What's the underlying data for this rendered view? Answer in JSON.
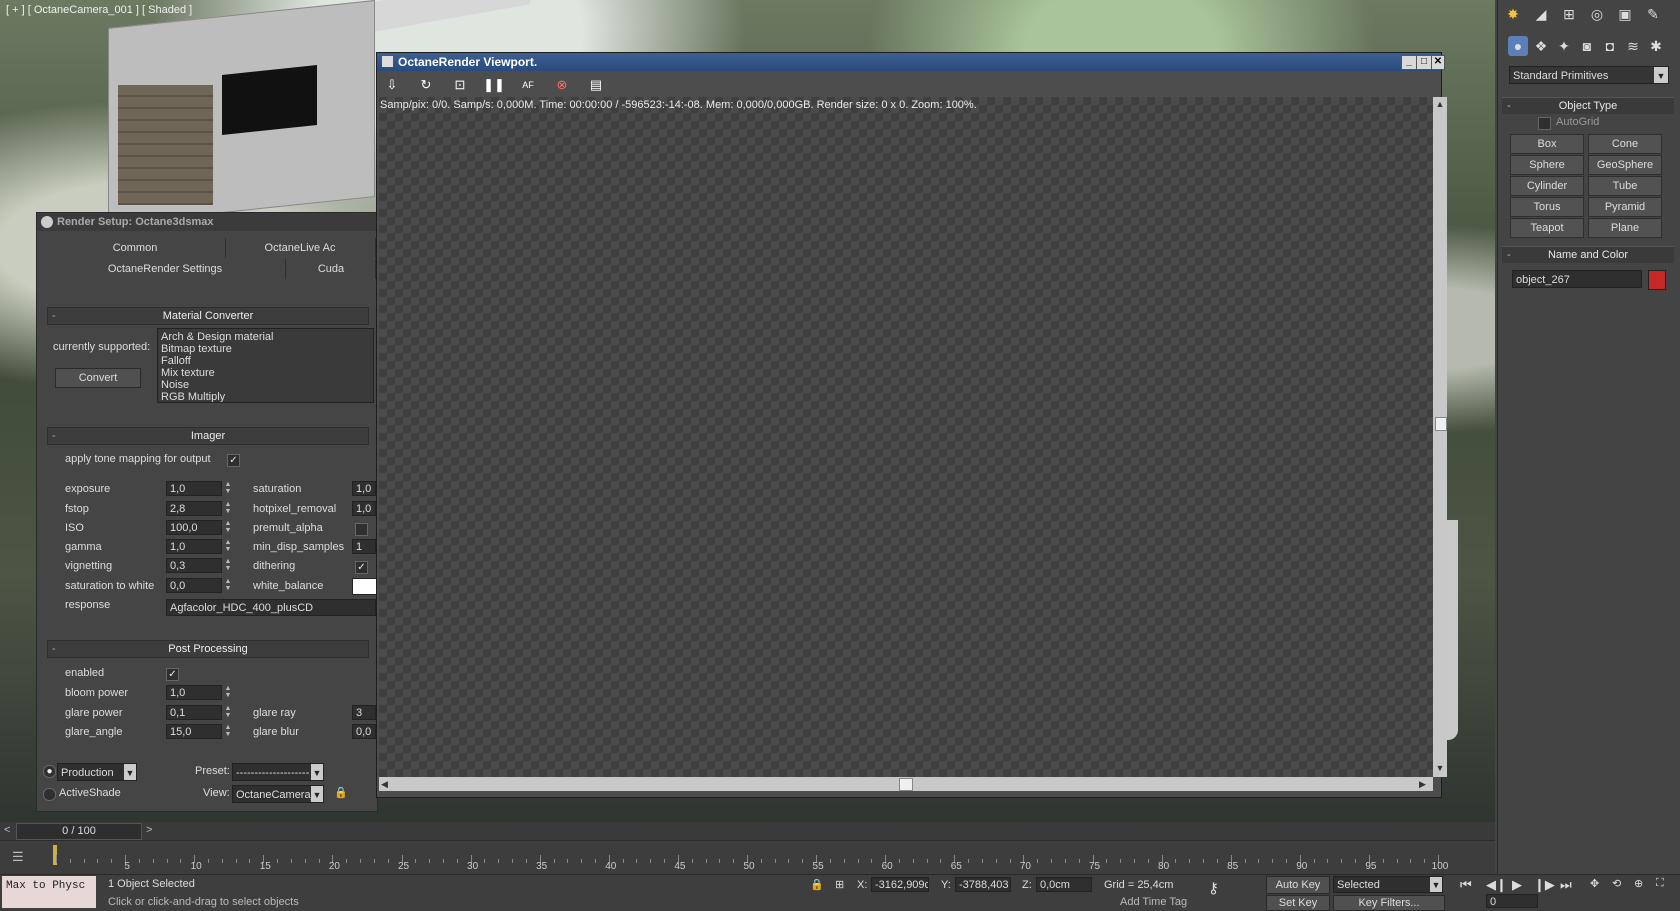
{
  "viewport": {
    "label": "[ + ] [ OctaneCamera_001 ] [ Shaded ]"
  },
  "command_panel": {
    "dropdown": "Standard Primitives",
    "object_type": {
      "title": "Object Type",
      "autogrid": "AutoGrid",
      "buttons": [
        "Box",
        "Cone",
        "Sphere",
        "GeoSphere",
        "Cylinder",
        "Tube",
        "Torus",
        "Pyramid",
        "Teapot",
        "Plane"
      ]
    },
    "name_color": {
      "title": "Name and Color",
      "name": "object_267",
      "color": "#c62828"
    }
  },
  "render_setup": {
    "title": "Render Setup: Octane3dsmax",
    "tabs_row1": [
      "Common",
      "OctaneLive Ac"
    ],
    "tabs_row2": [
      "OctaneRender Settings",
      "Cuda"
    ],
    "material_converter": {
      "title": "Material Converter",
      "currently_supported": "currently supported:",
      "convert": "Convert",
      "list": [
        "Arch & Design material",
        "Bitmap texture",
        "Falloff",
        "Mix texture",
        "Noise",
        "RGB Multiply"
      ]
    },
    "imager": {
      "title": "Imager",
      "tone_mapping": "apply tone mapping for output",
      "left": [
        {
          "label": "exposure",
          "value": "1,0"
        },
        {
          "label": "fstop",
          "value": "2,8"
        },
        {
          "label": "ISO",
          "value": "100,0"
        },
        {
          "label": "gamma",
          "value": "1,0"
        },
        {
          "label": "vignetting",
          "value": "0,3"
        },
        {
          "label": "saturation to white",
          "value": "0,0"
        }
      ],
      "right": [
        {
          "label": "saturation",
          "value": "1,0"
        },
        {
          "label": "hotpixel_removal",
          "value": "1,0"
        },
        {
          "label": "premult_alpha",
          "value": ""
        },
        {
          "label": "min_disp_samples",
          "value": "1"
        },
        {
          "label": "dithering",
          "value": ""
        },
        {
          "label": "white_balance",
          "value": ""
        }
      ],
      "response_label": "response",
      "response_value": "Agfacolor_HDC_400_plusCD"
    },
    "post_processing": {
      "title": "Post Processing",
      "enabled": "enabled",
      "bloom_power_label": "bloom power",
      "bloom_power": "1,0",
      "glare_power_label": "glare power",
      "glare_power": "0,1",
      "glare_angle_label": "glare_angle",
      "glare_angle": "15,0",
      "glare_ray_label": "glare ray",
      "glare_ray": "3",
      "glare_blur_label": "glare blur",
      "glare_blur": "0,0"
    },
    "bottom": {
      "production": "Production",
      "activeshade": "ActiveShade",
      "preset_label": "Preset:",
      "preset_value": "--------------------",
      "view_label": "View:",
      "view_value": "OctaneCamera_"
    }
  },
  "octane_viewport": {
    "title": "OctaneRender Viewport.",
    "status": "Samp/pix: 0/0.   Samp/s: 0,000M.   Time: 00:00:00 / -596523:-14:-08.   Mem: 0,000/0,000GB.   Render size: 0 x 0.   Zoom: 100%."
  },
  "timeline": {
    "counter": "0 / 100",
    "ticks": [
      "5",
      "10",
      "15",
      "20",
      "25",
      "30",
      "35",
      "40",
      "45",
      "50",
      "55",
      "60",
      "65",
      "70",
      "75",
      "80",
      "85",
      "90",
      "95",
      "100"
    ]
  },
  "status": {
    "maxscript": "Max to Physc",
    "selected_count": "1 Object Selected",
    "hint": "Click or click-and-drag to select objects",
    "x_label": "X:",
    "x_value": "-3162,909c",
    "y_label": "Y:",
    "y_value": "-3788,403",
    "z_label": "Z:",
    "z_value": "0,0cm",
    "grid": "Grid = 25,4cm",
    "autokey": "Auto Key",
    "selected_dropdown": "Selected",
    "setkey": "Set Key",
    "key_filters": "Key Filters...",
    "add_time_tag": "Add Time Tag",
    "frame": "0"
  }
}
